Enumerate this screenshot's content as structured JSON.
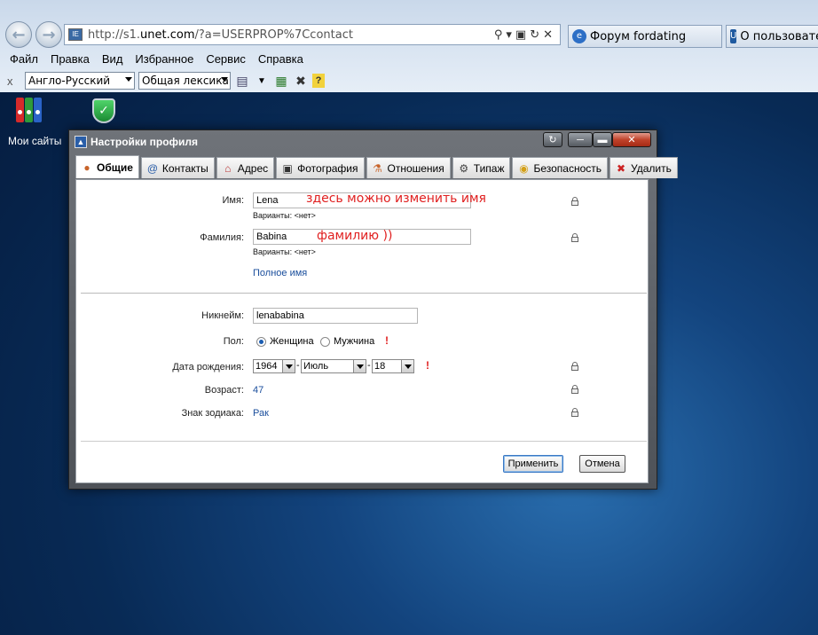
{
  "browser": {
    "url_prefix": "http://s1.",
    "url_domain": "unet.com",
    "url_suffix": "/?a=USERPROP%7Ccontact",
    "favicon": "IE",
    "tabs": [
      {
        "label": "Форум fordating",
        "icon": "ie-icon"
      },
      {
        "label": "О пользовател",
        "icon": "u-icon"
      }
    ],
    "menu": [
      "Файл",
      "Правка",
      "Вид",
      "Избранное",
      "Сервис",
      "Справка"
    ],
    "translator": {
      "close_glyph": "x",
      "language": "Англо-Русский",
      "topic": "Общая лексика"
    }
  },
  "desktop": {
    "my_sites_label": "Мои сайты"
  },
  "dialog": {
    "title": "Настройки профиля",
    "tabs": [
      {
        "label": "Общие",
        "icon": "👤"
      },
      {
        "label": "Контакты",
        "icon": "@"
      },
      {
        "label": "Адрес",
        "icon": "🏠"
      },
      {
        "label": "Фотография",
        "icon": "📷"
      },
      {
        "label": "Отношения",
        "icon": "⚇"
      },
      {
        "label": "Типаж",
        "icon": "⚙"
      },
      {
        "label": "Безопасность",
        "icon": "🔒"
      },
      {
        "label": "Удалить",
        "icon": "✖"
      }
    ],
    "form": {
      "first_name_label": "Имя:",
      "first_name_value": "Lena",
      "first_name_note": "здесь можно изменить имя",
      "first_name_variants": "Варианты: <нет>",
      "last_name_label": "Фамилия:",
      "last_name_value": "Babina",
      "last_name_note": "фамилию ))",
      "last_name_variants": "Варианты: <нет>",
      "full_name_link": "Полное имя",
      "nickname_label": "Никнейм:",
      "nickname_value": "lenababina",
      "gender_label": "Пол:",
      "gender_female": "Женщина",
      "gender_male": "Мужчина",
      "gender_selected": "female",
      "required_mark": "!",
      "birthdate_label": "Дата рождения:",
      "birth_year": "1964",
      "birth_month": "Июль",
      "birth_day": "18",
      "date_separator": "-",
      "age_label": "Возраст:",
      "age_value": "47",
      "zodiac_label": "Знак зодиака:",
      "zodiac_value": "Рак"
    },
    "buttons": {
      "apply": "Применить",
      "cancel": "Отмена"
    }
  }
}
